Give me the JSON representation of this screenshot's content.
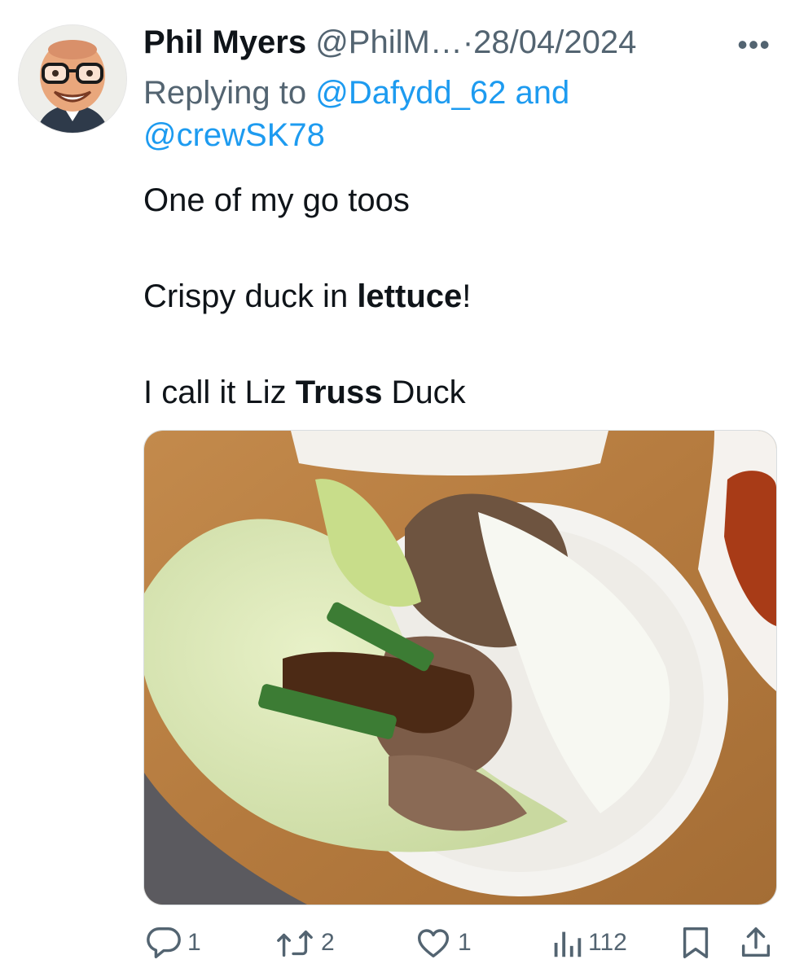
{
  "tweet": {
    "author_name": "Phil Myers",
    "handle": "@PhilM…",
    "separator": "·",
    "date": "28/04/2024",
    "more_label": "•••",
    "replying_prefix": "Replying to",
    "reply_to_1": "@Dafydd_62",
    "reply_and": "and",
    "reply_to_2": "@crewSK78",
    "text_line1": "One of my go toos",
    "text_line2_pre": "Crispy duck in ",
    "text_line2_bold": "lettuce",
    "text_line2_post": "!",
    "text_line3_pre": "I call it Liz ",
    "text_line3_bold": "Truss",
    "text_line3_post": " Duck"
  },
  "actions": {
    "replies": "1",
    "retweets": "2",
    "likes": "1",
    "views": "112"
  },
  "colors": {
    "link": "#1d9bf0",
    "muted": "#536471",
    "text": "#0f1419"
  },
  "icons": [
    "reply-icon",
    "retweet-icon",
    "like-icon",
    "views-icon",
    "bookmark-icon",
    "share-icon",
    "more-icon"
  ]
}
